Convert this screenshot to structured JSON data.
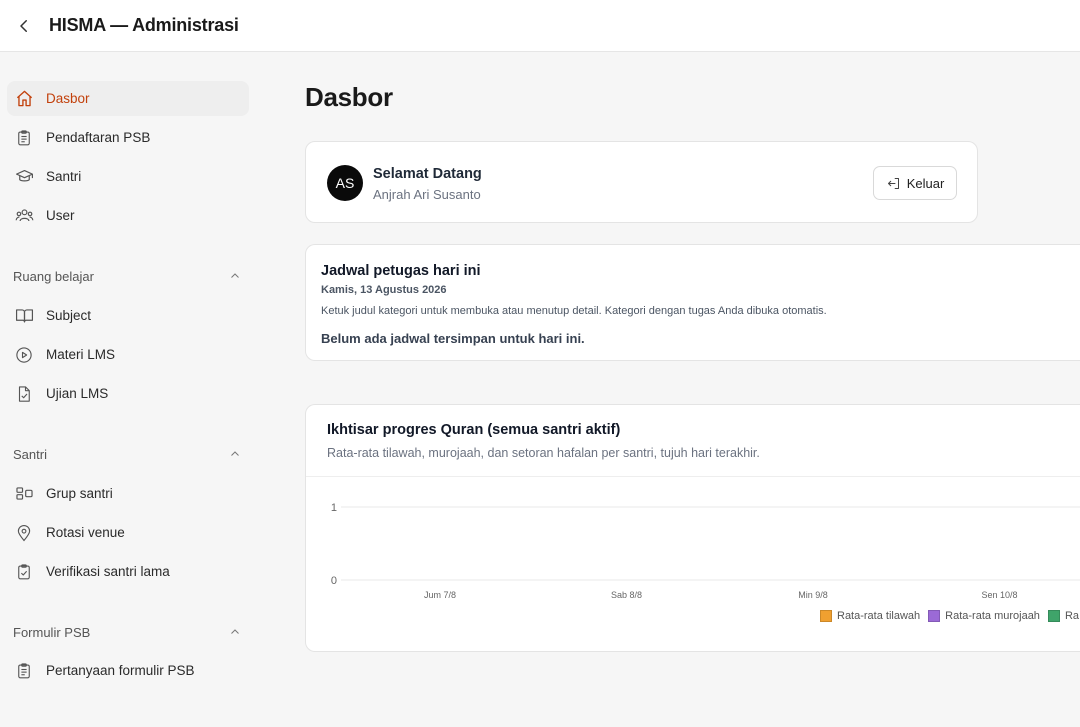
{
  "header": {
    "title": "HISMA — Administrasi",
    "back_icon": "chevron-left-icon"
  },
  "sidebar": {
    "top_items": [
      {
        "label": "Dasbor",
        "icon": "home-icon",
        "active": true
      },
      {
        "label": "Pendaftaran PSB",
        "icon": "clipboard-icon"
      },
      {
        "label": "Santri",
        "icon": "graduation-cap-icon"
      },
      {
        "label": "User",
        "icon": "users-icon"
      }
    ],
    "groups": [
      {
        "label": "Ruang belajar",
        "items": [
          {
            "label": "Subject",
            "icon": "book-open-icon"
          },
          {
            "label": "Materi LMS",
            "icon": "play-circle-icon"
          },
          {
            "label": "Ujian LMS",
            "icon": "file-check-icon"
          }
        ]
      },
      {
        "label": "Santri",
        "items": [
          {
            "label": "Grup santri",
            "icon": "group-icon"
          },
          {
            "label": "Rotasi venue",
            "icon": "map-pin-icon"
          },
          {
            "label": "Verifikasi santri lama",
            "icon": "clipboard-check-icon"
          }
        ]
      },
      {
        "label": "Formulir PSB",
        "items": [
          {
            "label": "Pertanyaan formulir PSB",
            "icon": "clipboard-icon"
          }
        ]
      }
    ]
  },
  "main": {
    "page_title": "Dasbor",
    "welcome": {
      "avatar_initials": "AS",
      "title": "Selamat Datang",
      "name": "Anjrah Ari Susanto",
      "logout_label": "Keluar"
    },
    "schedule": {
      "title": "Jadwal petugas hari ini",
      "date": "Kamis, 13 Agustus 2026",
      "hint": "Ketuk judul kategori untuk membuka atau menutup detail. Kategori dengan tugas Anda dibuka otomatis.",
      "empty_text": "Belum ada jadwal tersimpan untuk hari ini."
    },
    "chart_card": {
      "title": "Ikhtisar progres Quran (semua santri aktif)",
      "subtitle": "Rata-rata tilawah, murojaah, dan setoran hafalan per santri, tujuh hari terakhir."
    }
  },
  "chart_data": {
    "type": "line",
    "x": [
      "Jum 7/8",
      "Sab 8/8",
      "Min 9/8",
      "Sen 10/8"
    ],
    "ylim": [
      0,
      1
    ],
    "yticks": [
      "0",
      "1"
    ],
    "series": [
      {
        "name": "Rata-rata tilawah",
        "color": "#f0a030",
        "values": []
      },
      {
        "name": "Rata-rata murojaah",
        "color": "#9b6ad6",
        "values": []
      },
      {
        "name": "Ra",
        "color": "#3fa46a",
        "values": []
      }
    ],
    "grid": true,
    "legend": "bottom-right"
  }
}
